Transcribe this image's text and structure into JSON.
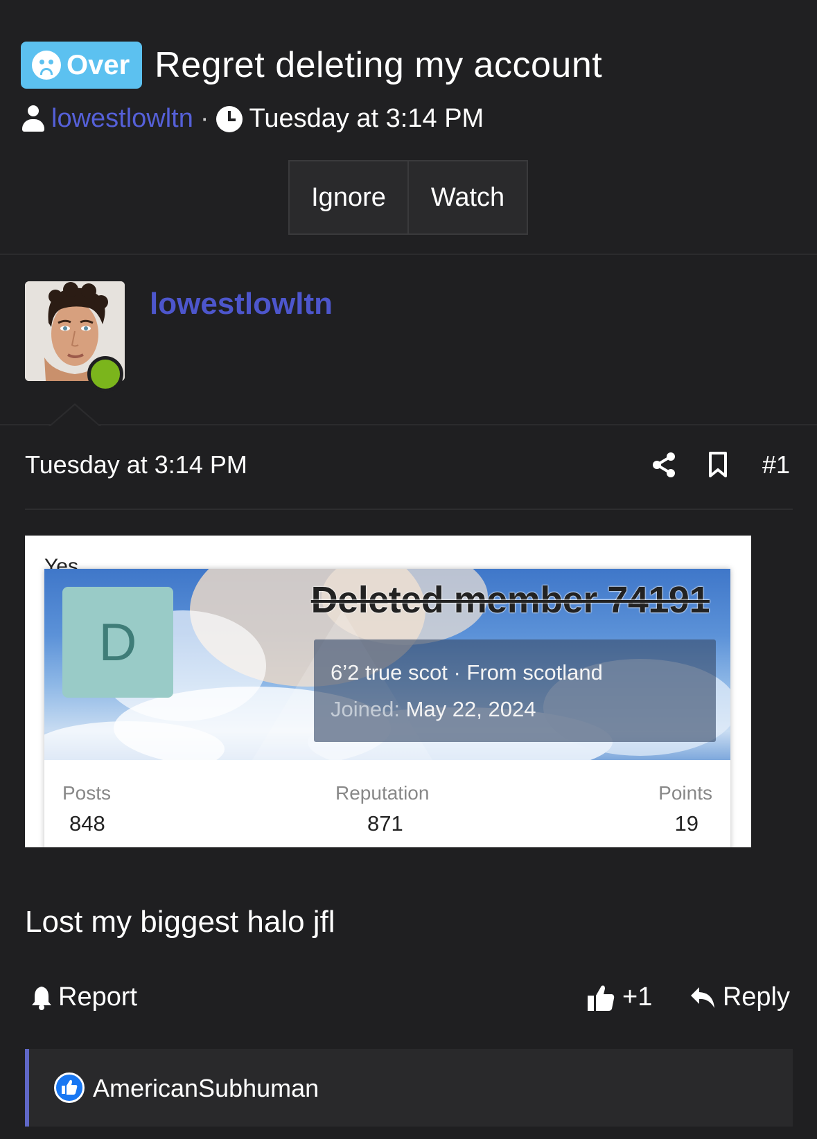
{
  "thread": {
    "prefix": "Over",
    "title": "Regret deleting my account",
    "author": "lowestlowltn",
    "separator": "·",
    "time": "Tuesday at 3:14 PM",
    "buttons": {
      "ignore": "Ignore",
      "watch": "Watch"
    }
  },
  "post": {
    "username": "lowestlowltn",
    "date": "Tuesday at 3:14 PM",
    "number": "#1",
    "body": "Lost my biggest halo jfl",
    "actions": {
      "report": "Report",
      "like_count": "+1",
      "reply": "Reply"
    },
    "reactions": {
      "user": "AmericanSubhuman"
    }
  },
  "embed": {
    "cutoff_text": "Yes",
    "avatar_letter": "D",
    "name": "Deleted member 74191",
    "tagline": "6’2 true scot · From scotland",
    "joined_label": "Joined:",
    "joined_date": "May 22, 2024",
    "stats": {
      "posts_label": "Posts",
      "posts": "848",
      "reputation_label": "Reputation",
      "reputation": "871",
      "points_label": "Points",
      "points": "19"
    }
  },
  "icons": {
    "prefix": "frown-icon",
    "user": "user-icon",
    "clock": "clock-icon",
    "share": "share-icon",
    "bookmark": "bookmark-icon",
    "report": "bell-icon",
    "like": "thumbs-up-icon",
    "reply": "reply-icon"
  },
  "colors": {
    "background": "#1f1f21",
    "prefix_badge": "#5cc1f0",
    "link": "#4d56cc",
    "online": "#7bb51c",
    "reaction_accent": "#5f67c7",
    "like_badge": "#1877f2"
  }
}
